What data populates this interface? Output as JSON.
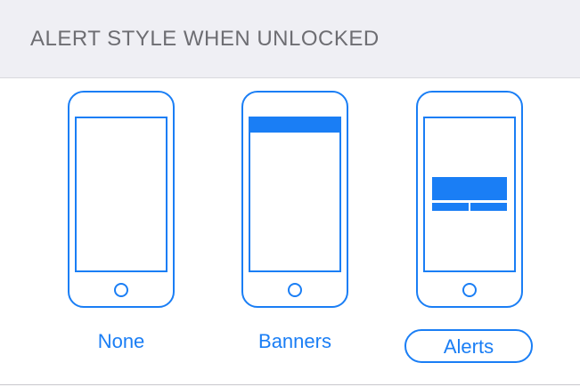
{
  "section": {
    "title": "ALERT STYLE WHEN UNLOCKED"
  },
  "options": [
    {
      "label": "None",
      "illustration": "phone-icon",
      "selected": false
    },
    {
      "label": "Banners",
      "illustration": "phone-banner-icon",
      "selected": false
    },
    {
      "label": "Alerts",
      "illustration": "phone-alert-icon",
      "selected": true
    }
  ],
  "colors": {
    "accent": "#1a7ef5",
    "header_bg": "#efeff4",
    "header_text": "#6d6d72"
  }
}
